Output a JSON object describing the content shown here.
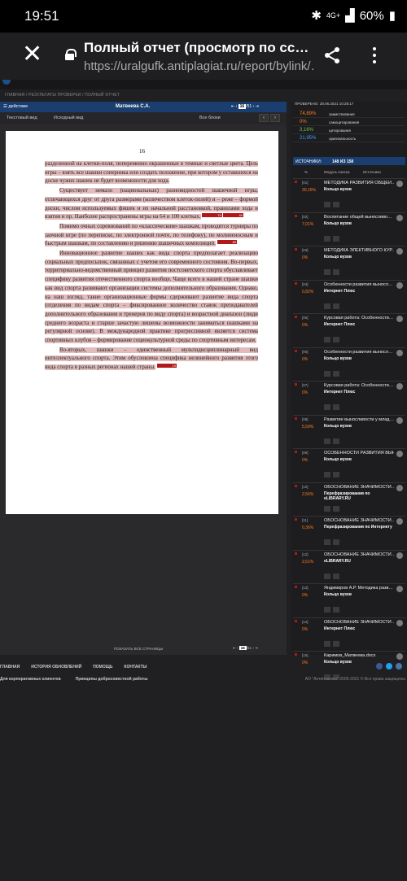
{
  "status": {
    "time": "19:51",
    "network": "4G+",
    "battery": "60%"
  },
  "browser": {
    "title": "Полный отчет (просмотр по сс…",
    "url": "https://uralgufk.antiplagiat.ru/report/bylink/…"
  },
  "breadcrumb": "ГЛАВНАЯ / РЕЗУЛЬТАТЫ ПРОВЕРКИ / ПОЛНЫЙ ОТЧЕТ",
  "viewer": {
    "action_label": "действие",
    "author": "Матвеева С.А.",
    "page": "16",
    "page_total": "/51",
    "tabs": [
      "Текстовый вид",
      "Исходный вид",
      "Все блоки"
    ],
    "show_all_pages": "ПОКАЗАТЬ ВСЕ СТРАНИЦЫ",
    "page_number": "16",
    "paragraphs": [
      "разделенной на клетки-поля, попеременно окрашенные в темные и светлые цвета. Цель игры – взять все шашки соперника или создать положение, при котором у оставшихся на доске чужих шашек не будет возможности для хода.",
      "Существует немало (национальных) разновидностей шашечной игры, отличающихся друг от друга размерами (количеством клеток-полей) и – реже – формой доски, числом используемых фишек и их начальной расстановкой, правилами хода и взятия и пр. Наиболее распространены игры на 64 и 100 клетках.",
      "Помимо очных соревнований по «классическим» шашкам, проводятся турниры по заочной игре (по переписке, по электронной почте, по телефону), по молниеносным и быстрым шашкам, по составлению и решению шашечных композиций.",
      "Инновационное развитие шашек как вида спорта предполагает реализацию социальных предпосылок, связанных с учетом его современного состояния. Во-первых, территориально-ведомственный принцип развития постсоветского спорта обуславливает специфику развития отечественного спорта вообще. Чаще всего в нашей стране шашки как вид спорта развивают организации системы дополнительного образования. Однако, на наш взгляд, такие организационные формы сдерживают развитие вида спорта (отделения по видам спорта – фиксированное количество ставок преподавателей дополнительного образования и тренеров по виду спорта) и возрастной диапазон (люди среднего возраста и старше зачастую лишены возможности заниматься шашками на регулярной основе). В международной практике прогрессивной является система спортивных клубов – формирование социокультурной среды по спортивным интересам.",
      "Во-вторых, шашки – единственный мультидисциплинарный вид интеллектуального спорта. Этим обусловлена специфика нелинейного развития этого вида спорта в разных регионах нашей страны."
    ],
    "tags": [
      "75",
      "49",
      "89",
      "19"
    ]
  },
  "sidebar": {
    "check_label": "ПРОВЕРЕНО:",
    "check_date": "28.06.2021 10:28:17",
    "stats": [
      {
        "value": "74,89%",
        "label": "заимствования",
        "color": "#ff7a1a"
      },
      {
        "value": "0%",
        "label": "самоцитирования",
        "color": "#ff7a1a"
      },
      {
        "value": "3,16%",
        "label": "цитирования",
        "color": "#6cc24a"
      },
      {
        "value": "21,95%",
        "label": "оригинальность",
        "color": "#3aa0ff"
      }
    ],
    "sources_label": "ИСТОЧНИКИ:",
    "sources_count": "148 ИЗ 158",
    "col_headers": [
      "%",
      "Модуль поиска",
      "Источники"
    ],
    "sources": [
      {
        "n": "[01]",
        "p": "30,16%",
        "t": "МЕТОДИКА РАЗВИТИЯ ОБЩЕЙ…",
        "s": "Кольцо вузов"
      },
      {
        "n": "[02]",
        "p": "7,01%",
        "t": "Воспитание общей выносливо…",
        "s": "Кольцо вузов"
      },
      {
        "n": "[03]",
        "p": "0%",
        "t": "МЕТОДИКА ЭЛЕКТИВНОГО КУР…",
        "s": "Кольцо вузов"
      },
      {
        "n": "[04]",
        "p": "0,82%",
        "t": "Особенности развития выносл…",
        "s": "Интернет Плюс"
      },
      {
        "n": "[05]",
        "p": "0%",
        "t": "Курсовая работа: Особенности…",
        "s": "Интернет Плюс"
      },
      {
        "n": "[06]",
        "p": "0%",
        "t": "Особенности развития выносл…",
        "s": "Кольцо вузов"
      },
      {
        "n": "[07]",
        "p": "0%",
        "t": "Курсовая работа: Особенности…",
        "s": "Интернет Плюс"
      },
      {
        "n": "[08]",
        "p": "5,59%",
        "t": "Развитие выносливости у млад…",
        "s": "Кольцо вузов"
      },
      {
        "n": "[09]",
        "p": "0%",
        "t": "ОСОБЕННОСТИ РАЗВИТИЯ ВЫН…",
        "s": "Кольцо вузов"
      },
      {
        "n": "[10]",
        "p": "2,56%",
        "t": "ОБОСНОВАНИЕ ЗНАЧИМОСТИ…",
        "s": "Перефразирования по eLIBRARY.RU"
      },
      {
        "n": "[11]",
        "p": "0,36%",
        "t": "ОБОСНОВАНИЕ ЗНАЧИМОСТИ…",
        "s": "Перефразирования по Интернету"
      },
      {
        "n": "[12]",
        "p": "2,61%",
        "t": "ОБОСНОВАНИЕ ЗНАЧИМОСТИ…",
        "s": "eLIBRARY.RU"
      },
      {
        "n": "[13]",
        "p": "0%",
        "t": "Яндимиров А.Р. Методика разв…",
        "s": "Кольцо вузов"
      },
      {
        "n": "[14]",
        "p": "0%",
        "t": "ОБОСНОВАНИЕ ЗНАЧИМОСТИ…",
        "s": "Интернет Плюс"
      },
      {
        "n": "[15]",
        "p": "0%",
        "t": "Каримов_Матвеева.docx",
        "s": "Кольцо вузов"
      }
    ]
  },
  "footer": {
    "links": [
      "ГЛАВНАЯ",
      "ИСТОРИЯ ОБНОВЛЕНИЙ",
      "ПОМОЩЬ",
      "КОНТАКТЫ"
    ],
    "links2": [
      "Для корпоративных клиентов",
      "Принципы добросовестной работы"
    ],
    "copyright": "АО \"Антиплагиат\" 2005-2021 © Все права защищены"
  }
}
